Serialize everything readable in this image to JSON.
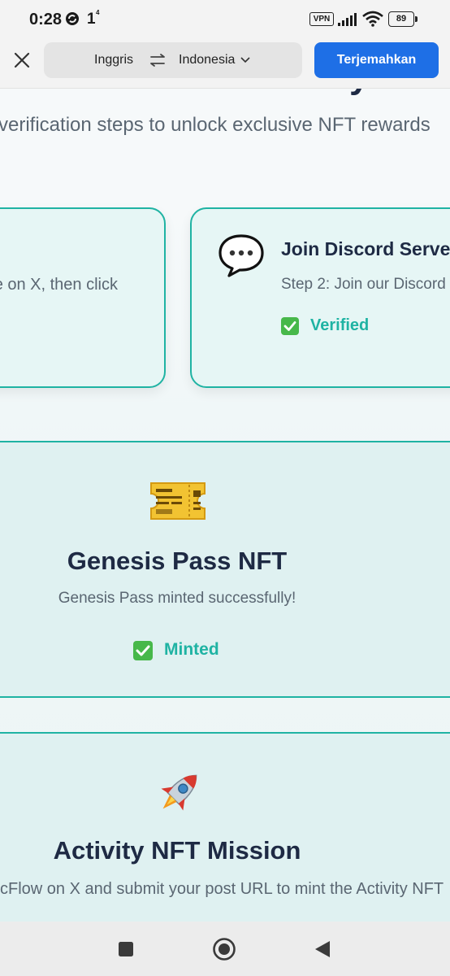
{
  "status_bar": {
    "time": "0:28",
    "notif_count": "1",
    "vpn_label": "VPN",
    "battery": "89"
  },
  "translate_bar": {
    "source_language": "Inggris",
    "target_language": "Indonesia",
    "translate_button": "Terjemahkan"
  },
  "page": {
    "heading_fragment": "y",
    "subtitle": "verification steps to unlock exclusive NFT rewards",
    "task_cards": [
      {
        "description": "e on X, then click"
      },
      {
        "icon": "speech-bubble-icon",
        "title": "Join Discord Server",
        "description": "Step 2: Join our Discord server",
        "status": "Verified"
      }
    ],
    "genesis_pass": {
      "icon": "ticket-icon",
      "title": "Genesis Pass NFT",
      "description": "Genesis Pass minted successfully!",
      "status": "Minted"
    },
    "activity_mission": {
      "icon": "rocket-icon",
      "title": "Activity NFT Mission",
      "description": "cFlow on X and submit your post URL to mint the Activity NFT"
    }
  },
  "colors": {
    "accent": "#1fb3a3",
    "heading": "#1e2a44",
    "body_text": "#5a6672",
    "translate_button_bg": "#1e6fe6",
    "check_green": "#47b84a"
  }
}
